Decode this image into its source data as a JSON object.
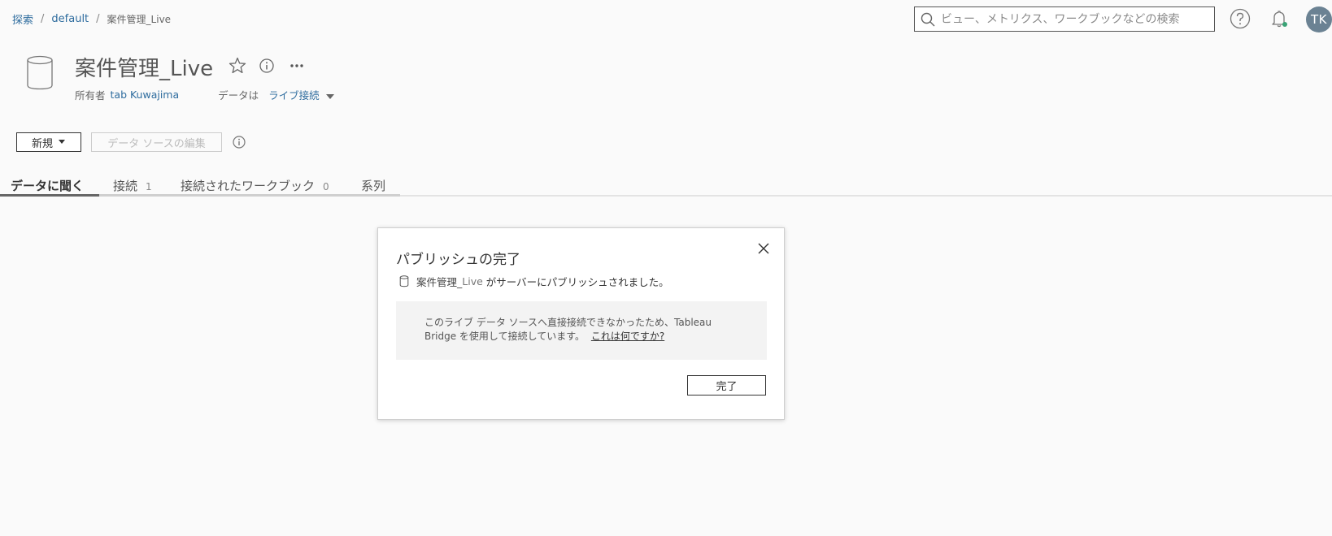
{
  "breadcrumb": {
    "items": [
      "探索",
      "default"
    ],
    "separator": "/",
    "current": "案件管理_Live"
  },
  "search": {
    "placeholder": "ビュー、メトリクス、ワークブックなどの検索"
  },
  "user": {
    "initials": "TK"
  },
  "datasource": {
    "title": "案件管理_Live",
    "owner_label": "所有者",
    "owner_name": "tab Kuwajima",
    "data_label": "データは",
    "data_value": "ライブ接続"
  },
  "toolbar": {
    "new_label": "新規",
    "edit_label": "データ ソースの編集"
  },
  "tabs": [
    {
      "label": "データに聞く",
      "count": ""
    },
    {
      "label": "接続",
      "count": "1"
    },
    {
      "label": "接続されたワークブック",
      "count": "0"
    },
    {
      "label": "系列",
      "count": ""
    }
  ],
  "dialog": {
    "title": "パブリッシュの完了",
    "ds_name": "案件管理_",
    "ds_name_suffix": "Live",
    "message": "がサーバーにパブリッシュされました。",
    "notice_line1": "このライブ データ ソースへ直接接続できなかったため、Tableau",
    "notice_line2": "Bridge を使用して接続しています。",
    "notice_link": "これは何ですか?",
    "done_label": "完了"
  },
  "colors": {
    "link": "#2e6c9e",
    "avatar_bg": "#6b8293",
    "notification_dot": "#3aa376"
  }
}
